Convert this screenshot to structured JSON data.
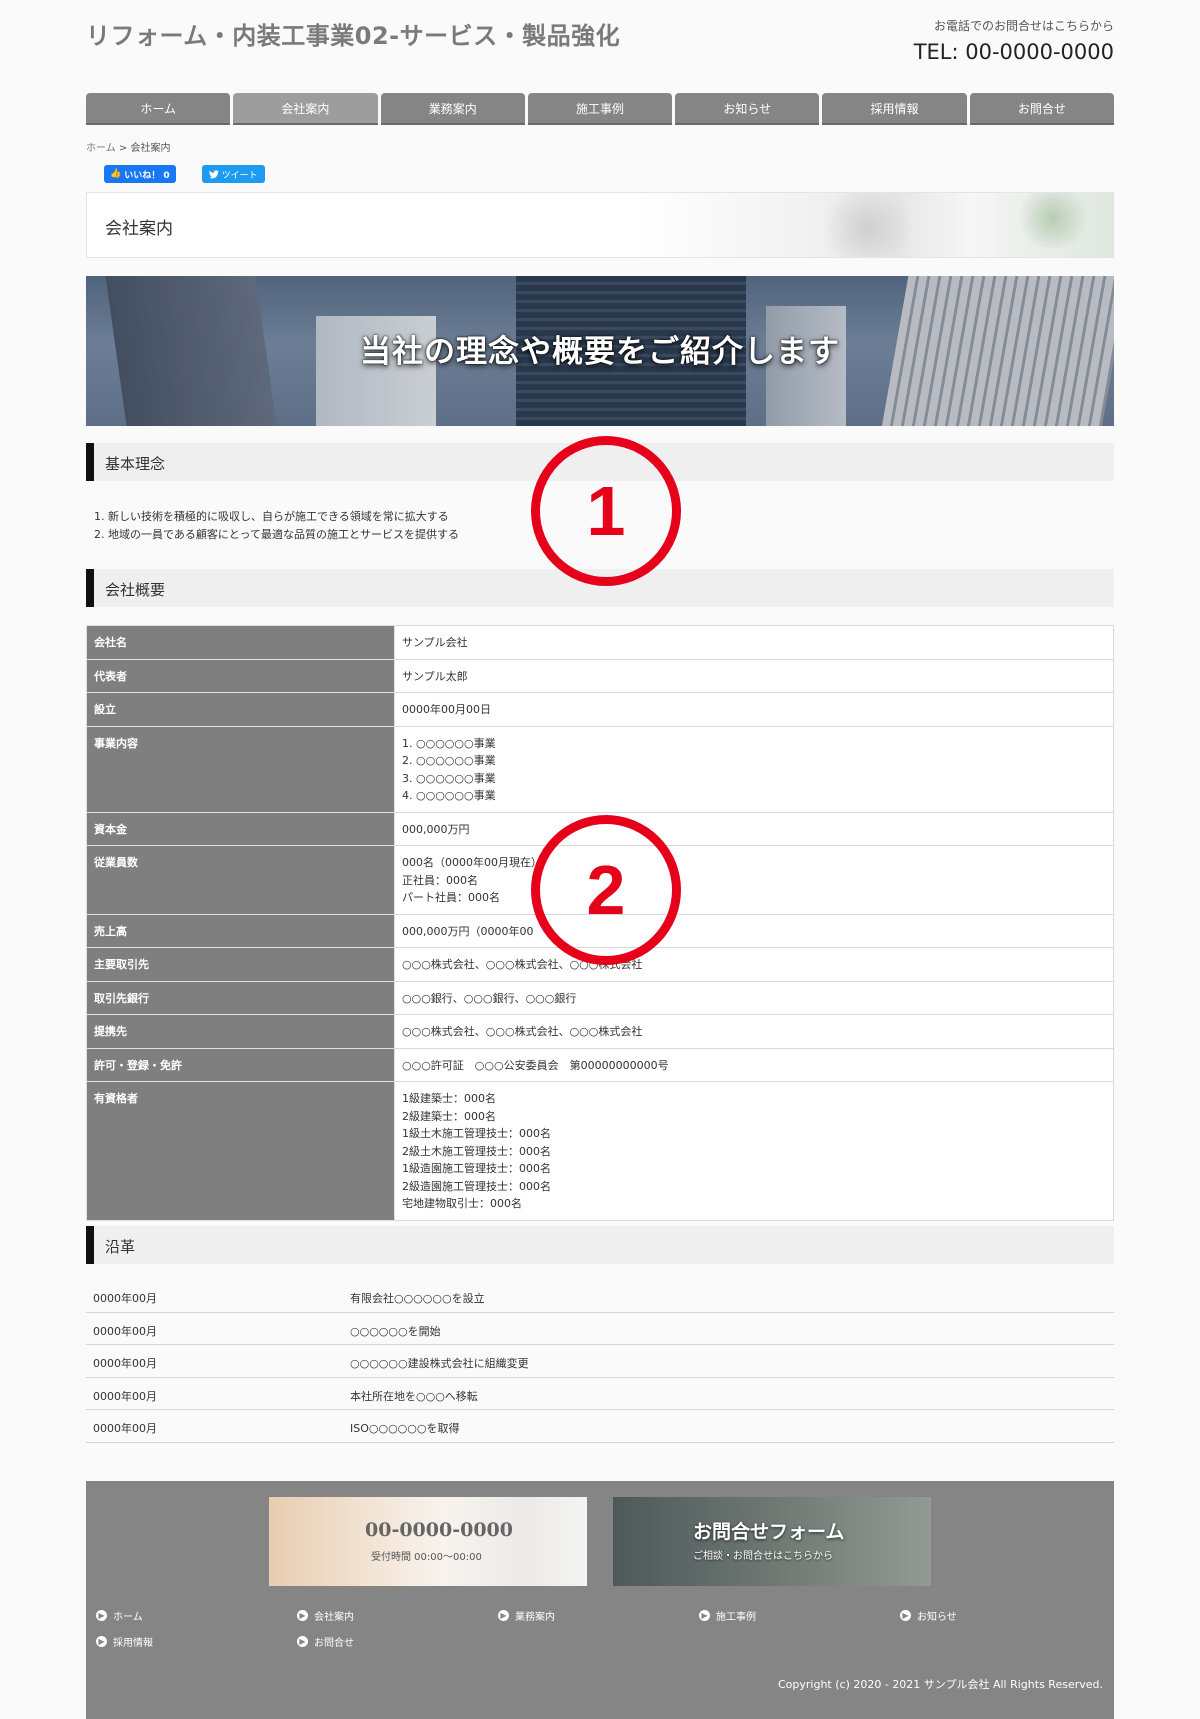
{
  "header": {
    "site_title": "リフォーム・内装工事業02-サービス・製品強化",
    "tel_note": "お電話でのお問合せはこちらから",
    "tel": "TEL: 00-0000-0000"
  },
  "nav": {
    "items": [
      "ホーム",
      "会社案内",
      "業務案内",
      "施工事例",
      "お知らせ",
      "採用情報",
      "お問合せ"
    ],
    "active_index": 1
  },
  "breadcrumb": {
    "home": "ホーム",
    "sep": " > ",
    "current": "会社案内"
  },
  "social": {
    "like_label": "いいね！ 0",
    "tweet_label": "ツイート"
  },
  "page_title": "会社案内",
  "hero": {
    "text": "当社の理念や概要をご紹介します"
  },
  "markers": [
    "1",
    "2"
  ],
  "philosophy": {
    "heading": "基本理念",
    "items": [
      "1. 新しい技術を積極的に吸収し、自らが施工できる領域を常に拡大する",
      "2. 地域の一員である顧客にとって最適な品質の施工とサービスを提供する"
    ]
  },
  "overview": {
    "heading": "会社概要",
    "rows": [
      {
        "key": "会社名",
        "lines": [
          "サンプル会社"
        ]
      },
      {
        "key": "代表者",
        "lines": [
          "サンプル太郎"
        ]
      },
      {
        "key": "設立",
        "lines": [
          "0000年00月00日"
        ]
      },
      {
        "key": "事業内容",
        "lines": [
          "1. ○○○○○○事業",
          "2. ○○○○○○事業",
          "3. ○○○○○○事業",
          "4. ○○○○○○事業"
        ]
      },
      {
        "key": "資本金",
        "lines": [
          "000,000万円"
        ]
      },
      {
        "key": "従業員数",
        "lines": [
          "000名（0000年00月現在）",
          "正社員：000名",
          "パート社員：000名"
        ]
      },
      {
        "key": "売上高",
        "lines": [
          "000,000万円（0000年00"
        ]
      },
      {
        "key": "主要取引先",
        "lines": [
          "○○○株式会社、○○○株式会社、○○○株式会社"
        ]
      },
      {
        "key": "取引先銀行",
        "lines": [
          "○○○銀行、○○○銀行、○○○銀行"
        ]
      },
      {
        "key": "提携先",
        "lines": [
          "○○○株式会社、○○○株式会社、○○○株式会社"
        ]
      },
      {
        "key": "許可・登録・免許",
        "lines": [
          "○○○許可証　○○○公安委員会　第00000000000号"
        ]
      },
      {
        "key": "有資格者",
        "lines": [
          "1級建築士：000名",
          "2級建築士：000名",
          "1級土木施工管理技士：000名",
          "2級土木施工管理技士：000名",
          "1級造園施工管理技士：000名",
          "2級造園施工管理技士：000名",
          "宅地建物取引士：000名"
        ]
      }
    ]
  },
  "history": {
    "heading": "沿革",
    "rows": [
      {
        "date": "0000年00月",
        "text": "有限会社○○○○○○を設立"
      },
      {
        "date": "0000年00月",
        "text": "○○○○○○を開始"
      },
      {
        "date": "0000年00月",
        "text": "○○○○○○建設株式会社に組織変更"
      },
      {
        "date": "0000年00月",
        "text": "本社所在地を○○○へ移転"
      },
      {
        "date": "0000年00月",
        "text": "ISO○○○○○○を取得"
      }
    ]
  },
  "footer": {
    "banner_tel": {
      "number": "00-0000-0000",
      "hours": "受付時間 00:00～00:00"
    },
    "banner_form": {
      "title": "お問合せフォーム",
      "sub": "ご相談・お問合せはこちらから"
    },
    "links": [
      "ホーム",
      "会社案内",
      "業務案内",
      "施工事例",
      "お知らせ",
      "採用情報",
      "お問合せ"
    ],
    "copyright": "Copyright (c) 2020 - 2021 サンプル会社 All Rights Reserved."
  },
  "colors": {
    "nav_bg": "#858585",
    "table_key_bg": "#7f7f7f",
    "marker": "#e6001a",
    "footer_bg": "#858585"
  }
}
